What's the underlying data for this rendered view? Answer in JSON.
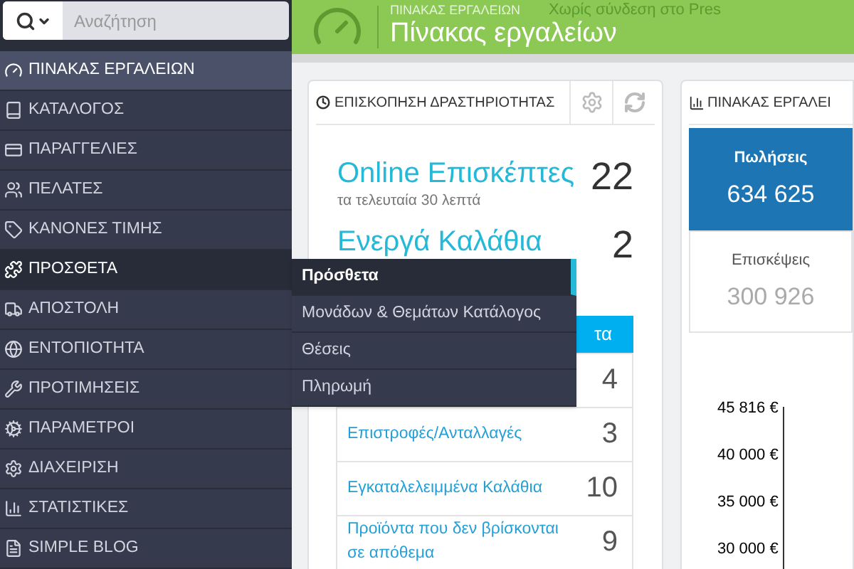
{
  "search": {
    "placeholder": "Αναζήτηση"
  },
  "sidebar": {
    "items": [
      {
        "label": "ΠΙΝΑΚΑΣ ΕΡΓΑΛΕΙΩΝ",
        "selected": true,
        "hovered": false
      },
      {
        "label": "ΚΑΤΑΛΟΓΟΣ",
        "selected": false,
        "hovered": false
      },
      {
        "label": "ΠΑΡΑΓΓΕΛΙΕΣ",
        "selected": false,
        "hovered": false
      },
      {
        "label": "ΠΕΛΑΤΕΣ",
        "selected": false,
        "hovered": false
      },
      {
        "label": "ΚΑΝΟΝΕΣ ΤΙΜΗΣ",
        "selected": false,
        "hovered": false
      },
      {
        "label": "ΠΡΟΣΘΕΤΑ",
        "selected": false,
        "hovered": true
      },
      {
        "label": "ΑΠΟΣΤΟΛΗ",
        "selected": false,
        "hovered": false
      },
      {
        "label": "ΕΝΤΟΠΙΟΤΗΤΑ",
        "selected": false,
        "hovered": false
      },
      {
        "label": "ΠΡΟΤΙΜΗΣΕΙΣ",
        "selected": false,
        "hovered": false
      },
      {
        "label": "ΠΑΡΑΜΕΤΡΟΙ",
        "selected": false,
        "hovered": false
      },
      {
        "label": "ΔΙΑΧΕΙΡΙΣΗ",
        "selected": false,
        "hovered": false
      },
      {
        "label": "ΣΤΑΤΙΣΤΙΚΕΣ",
        "selected": false,
        "hovered": false
      },
      {
        "label": "SIMPLE BLOG",
        "selected": false,
        "hovered": false
      }
    ]
  },
  "submenu": {
    "items": [
      {
        "label": "Πρόσθετα",
        "selected": true
      },
      {
        "label": "Μονάδων & Θεμάτων Κατάλογος",
        "selected": false
      },
      {
        "label": "Θέσεις",
        "selected": false
      },
      {
        "label": "Πληρωμή",
        "selected": false
      }
    ]
  },
  "header": {
    "breadcrumb": "ΠΙΝΑΚΑΣ ΕΡΓΑΛΕΙΩΝ",
    "title": "Πίνακας εργαλείων",
    "connection_status": "Χωρίς σύνδεση στο Pres"
  },
  "activity_panel": {
    "title": "ΕΠΙΣΚΟΠΗΣΗ ΔΡΑΣΤΗΡΙΟΤΗΤΑΣ",
    "online_visitors": {
      "label": "Online Επισκέπτες",
      "value": "22",
      "note": "τα τελευταία 30 λεπτά"
    },
    "active_carts": {
      "label": "Ενεργά Καλάθια",
      "value": "2"
    },
    "section_bar": "τα",
    "rows": [
      {
        "value": "4"
      },
      {
        "label": "Επιστροφές/Ανταλλαγές",
        "value": "3"
      },
      {
        "label": "Εγκαταλελειμμένα Καλάθια",
        "value": "10"
      },
      {
        "label": "Προϊόντα που δεν βρίσκονται σε απόθεμα",
        "value": "9"
      }
    ]
  },
  "dashboard_panel": {
    "title": "ΠΙΝΑΚΑΣ ΕΡΓΑΛΕΙ",
    "kpis": [
      {
        "label": "Πωλήσεις",
        "value": "634 625",
        "highlighted": true
      },
      {
        "label": "Επισκέψεις",
        "value": "300 926",
        "highlighted": false
      }
    ],
    "y_axis_labels": [
      "45 816 €",
      "40 000 €",
      "35 000 €",
      "30 000 €"
    ]
  }
}
